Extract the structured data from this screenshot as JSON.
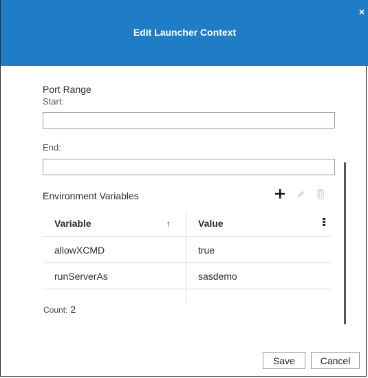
{
  "dialog": {
    "title": "Edit Launcher Context",
    "close_label": "×"
  },
  "port_range": {
    "title": "Port Range",
    "start_label": "Start:",
    "start_value": "",
    "end_label": "End:",
    "end_value": ""
  },
  "env": {
    "title": "Environment Variables",
    "columns": {
      "variable": "Variable",
      "value": "Value",
      "sort_indicator": "↑"
    },
    "rows": [
      {
        "variable": "allowXCMD",
        "value": "true"
      },
      {
        "variable": "runServerAs",
        "value": "sasdemo"
      }
    ],
    "count_label": "Count:",
    "count_value": "2"
  },
  "buttons": {
    "save": "Save",
    "cancel": "Cancel"
  },
  "colors": {
    "header_blue": "#1f7dc7"
  },
  "icons": [
    "close-icon",
    "add-icon",
    "edit-icon",
    "delete-icon",
    "sort-asc-icon",
    "column-menu-icon"
  ]
}
